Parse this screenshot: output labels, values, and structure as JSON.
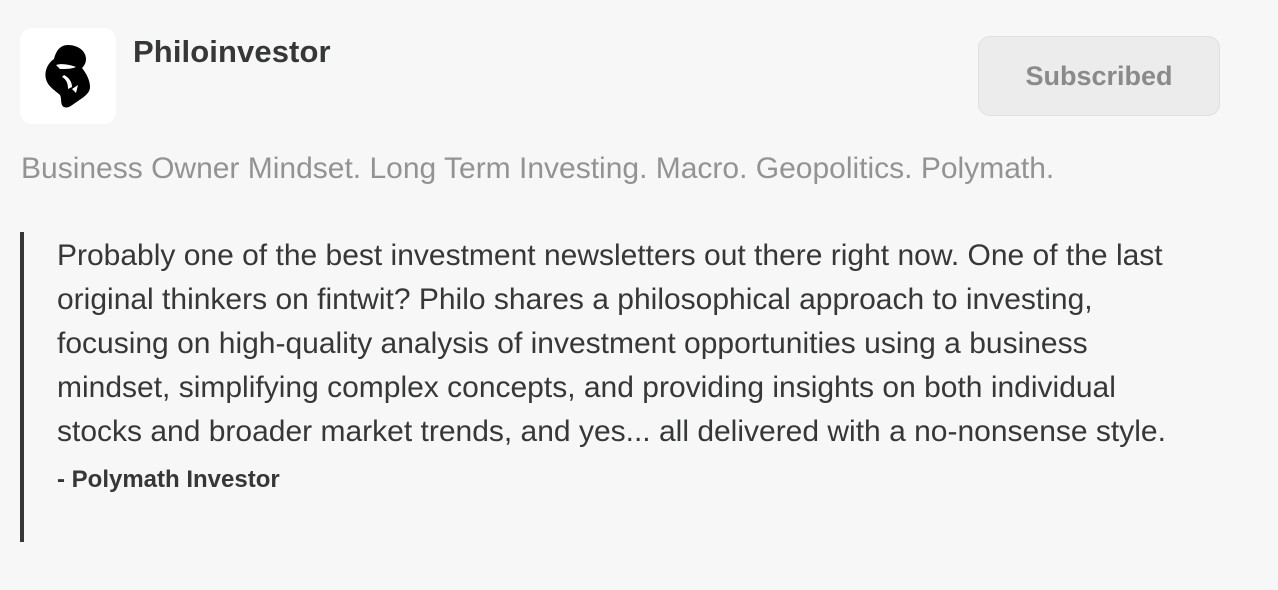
{
  "publication": {
    "name": "Philoinvestor",
    "logo_icon": "thinker-silhouette-icon",
    "tagline": "Business Owner Mindset. Long Term Investing. Macro. Geopolitics. Polymath."
  },
  "subscribe_button": {
    "label": "Subscribed"
  },
  "testimonial": {
    "text": "Probably one of the best investment newsletters out there right now. One of the last original thinkers on fintwit? Philo shares a philosophical approach to investing, focusing on high-quality analysis of investment opportunities using a business mindset, simplifying complex concepts, and providing insights on both individual stocks and broader market trends, and yes... all delivered with a no-nonsense style.",
    "author": "- Polymath Investor"
  },
  "colors": {
    "background": "#f7f7f7",
    "text": "#363737",
    "muted_text": "#939393",
    "button_bg": "#ececec",
    "button_text": "#8a8a8a"
  }
}
